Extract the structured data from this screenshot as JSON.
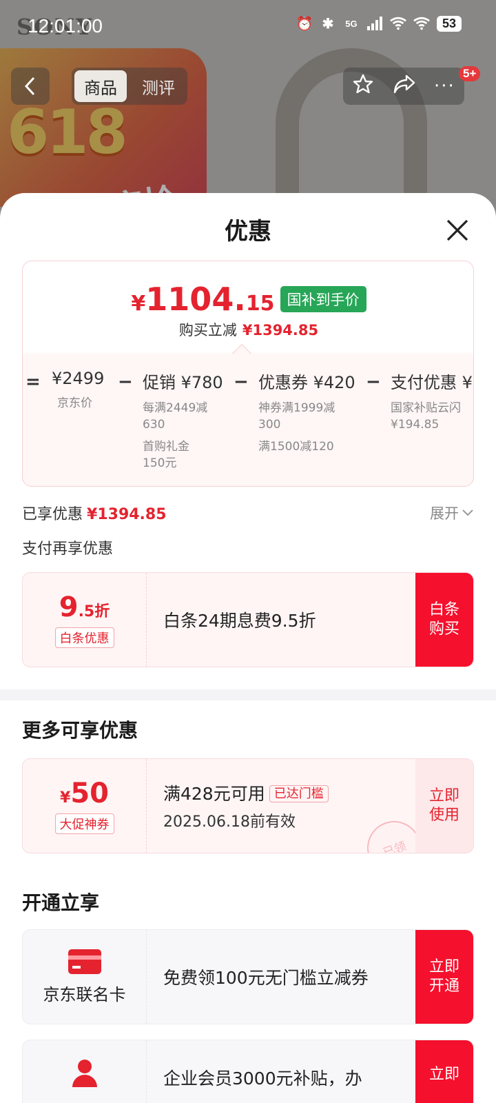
{
  "status_bar": {
    "time": "12:01:00",
    "brand": "SONY",
    "network": "5G",
    "battery": "53"
  },
  "background": {
    "promo_number": "618",
    "promo_text": "限时疯抢"
  },
  "top_nav": {
    "tabs": [
      "商品",
      "测评"
    ],
    "active_tab": 0,
    "message_badge": "5+"
  },
  "sheet": {
    "title": "优惠",
    "price_card": {
      "currency": "¥",
      "final_price_int": "1104.",
      "final_price_dec": "15",
      "tag": "国补到手价",
      "save_label": "购买立减",
      "save_amount": "¥1394.85",
      "breakdown": [
        {
          "op": "=",
          "head": "¥2499",
          "subs": [
            "京东价"
          ]
        },
        {
          "op": "−",
          "head": "促销 ¥780",
          "subs": [
            "每满2449减\n630",
            "首购礼金\n150元"
          ]
        },
        {
          "op": "−",
          "head": "优惠券 ¥420",
          "subs": [
            "神券满1999减\n300",
            "满1500减120"
          ]
        },
        {
          "op": "−",
          "head": "支付优惠 ¥",
          "subs": [
            "国家补贴云闪\n¥194.85"
          ]
        }
      ]
    },
    "enjoyed": {
      "label": "已享优惠",
      "amount": "¥1394.85",
      "expand_label": "展开"
    },
    "pay_section_title": "支付再享优惠",
    "baitiao": {
      "discount_big": "9",
      "discount_small": ".5折",
      "tag": "白条优惠",
      "desc": "白条24期息费9.5折",
      "button": "白条\n购买"
    },
    "more_section_title": "更多可享优惠",
    "promo_coupon": {
      "currency": "¥",
      "amount": "50",
      "tag": "大促神券",
      "condition": "满428元可用",
      "reached": "已达门槛",
      "validity": "2025.06.18前有效",
      "button": "立即\n使用",
      "stamp": "已领"
    },
    "open_section_title": "开通立享",
    "card_offer": {
      "name": "京东联名卡",
      "desc": "免费领100元无门槛立减券",
      "button": "立即\n开通"
    },
    "enterprise_offer": {
      "desc": "企业会员3000元补贴，办",
      "button": "立即"
    }
  }
}
